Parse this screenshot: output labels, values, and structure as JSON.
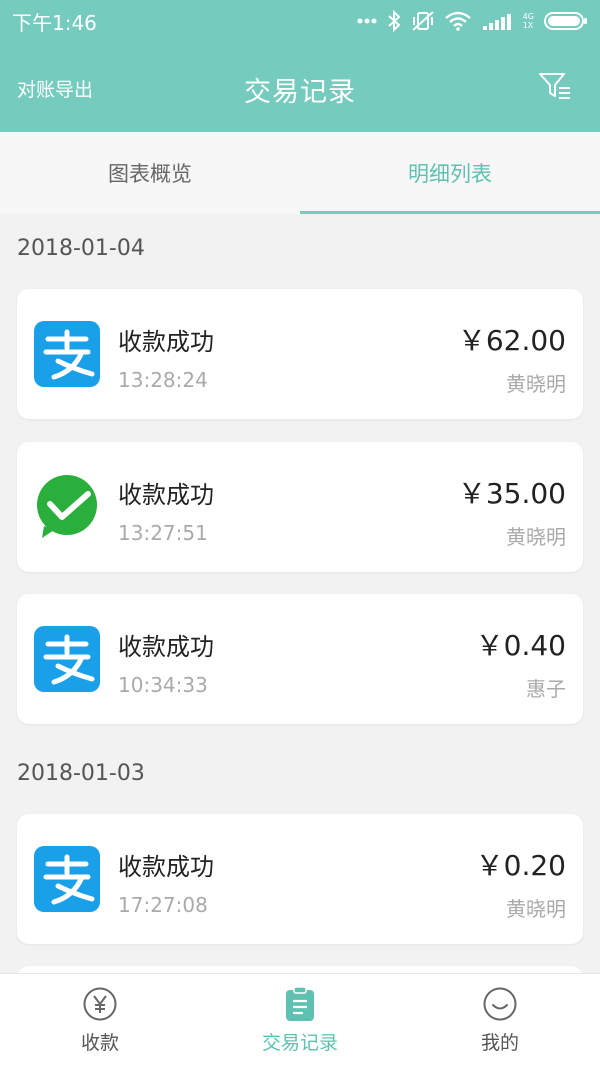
{
  "status": {
    "time": "下午1:46",
    "network": "4G",
    "sim": "1X"
  },
  "header": {
    "left_label": "对账导出",
    "title": "交易记录"
  },
  "tabs": [
    {
      "label": "图表概览",
      "active": false
    },
    {
      "label": "明细列表",
      "active": true
    }
  ],
  "groups": [
    {
      "date": "2018-01-04",
      "items": [
        {
          "method": "alipay",
          "title": "收款成功",
          "time": "13:28:24",
          "amount": "￥62.00",
          "payer": "黄晓明"
        },
        {
          "method": "wechat",
          "title": "收款成功",
          "time": "13:27:51",
          "amount": "￥35.00",
          "payer": "黄晓明"
        },
        {
          "method": "alipay",
          "title": "收款成功",
          "time": "10:34:33",
          "amount": "￥0.40",
          "payer": "惠子"
        }
      ]
    },
    {
      "date": "2018-01-03",
      "items": [
        {
          "method": "alipay",
          "title": "收款成功",
          "time": "17:27:08",
          "amount": "￥0.20",
          "payer": "黄晓明"
        }
      ]
    }
  ],
  "bottom_nav": [
    {
      "label": "收款",
      "icon": "yuan-circle-icon",
      "active": false
    },
    {
      "label": "交易记录",
      "icon": "clipboard-icon",
      "active": true
    },
    {
      "label": "我的",
      "icon": "smiley-icon",
      "active": false
    }
  ],
  "colors": {
    "primary": "#75cbbd",
    "alipay": "#1aa0e8",
    "wechat": "#2aae3c"
  }
}
